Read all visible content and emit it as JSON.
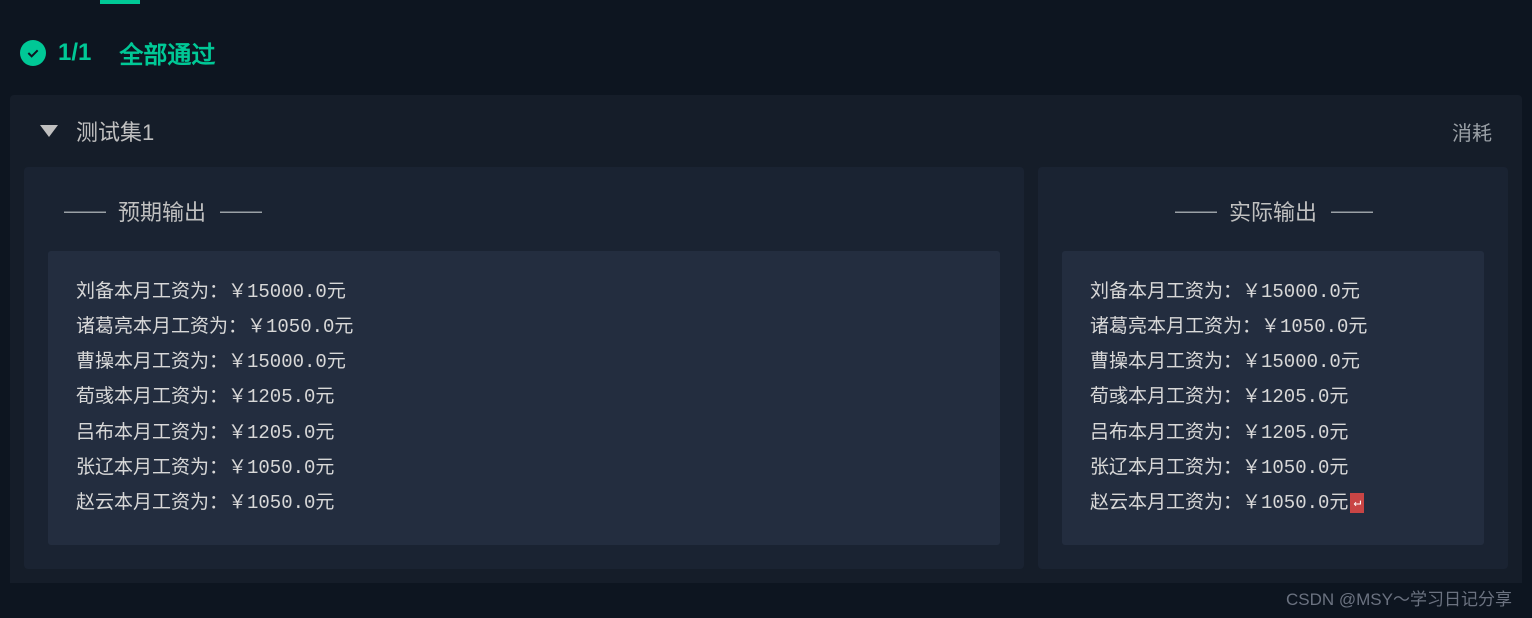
{
  "status": {
    "count": "1/1",
    "label": "全部通过"
  },
  "test": {
    "title": "测试集1",
    "right_label": "消耗"
  },
  "expected": {
    "label": "预期输出",
    "lines": [
      "刘备本月工资为：￥15000.0元",
      "诸葛亮本月工资为：￥1050.0元",
      "曹操本月工资为：￥15000.0元",
      "荀彧本月工资为：￥1205.0元",
      "吕布本月工资为：￥1205.0元",
      "张辽本月工资为：￥1050.0元",
      "赵云本月工资为：￥1050.0元"
    ]
  },
  "actual": {
    "label": "实际输出",
    "lines": [
      "刘备本月工资为：￥15000.0元",
      "诸葛亮本月工资为：￥1050.0元",
      "曹操本月工资为：￥15000.0元",
      "荀彧本月工资为：￥1205.0元",
      "吕布本月工资为：￥1205.0元",
      "张辽本月工资为：￥1050.0元",
      "赵云本月工资为：￥1050.0元"
    ],
    "eol_symbol": "↵"
  },
  "watermark": "CSDN @MSY～学习日记分享"
}
